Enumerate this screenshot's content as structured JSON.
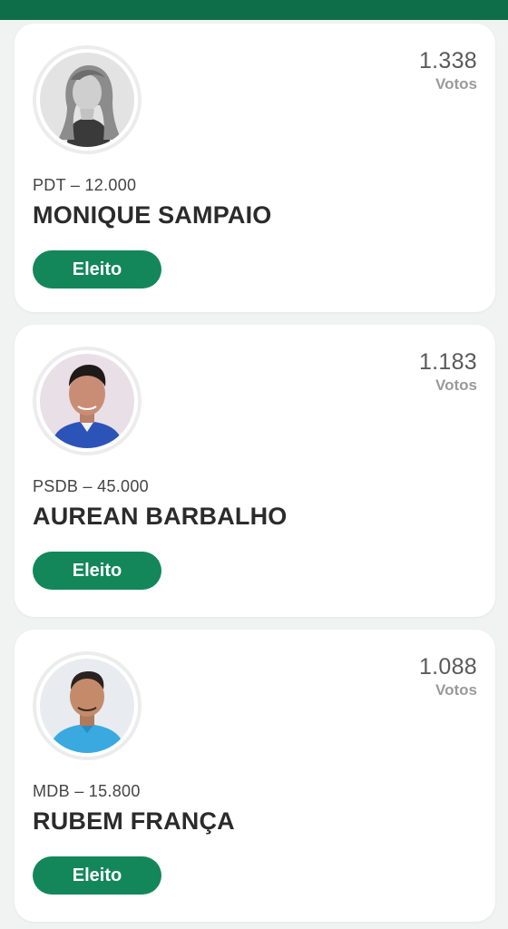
{
  "candidates": [
    {
      "votes": "1.338",
      "votes_label": "Votos",
      "party": "PDT – 12.000",
      "name": "MONIQUE SAMPAIO",
      "status": "Eleito",
      "photo": "grayscale-portrait-woman"
    },
    {
      "votes": "1.183",
      "votes_label": "Votos",
      "party": "PSDB – 45.000",
      "name": "AUREAN BARBALHO",
      "status": "Eleito",
      "photo": "portrait-man-blue-shirt"
    },
    {
      "votes": "1.088",
      "votes_label": "Votos",
      "party": "MDB – 15.800",
      "name": "RUBEM FRANÇA",
      "status": "Eleito",
      "photo": "portrait-man-light-blue-shirt"
    }
  ],
  "colors": {
    "header": "#0f6e4a",
    "badge": "#14875a",
    "background": "#f1f2f2"
  }
}
